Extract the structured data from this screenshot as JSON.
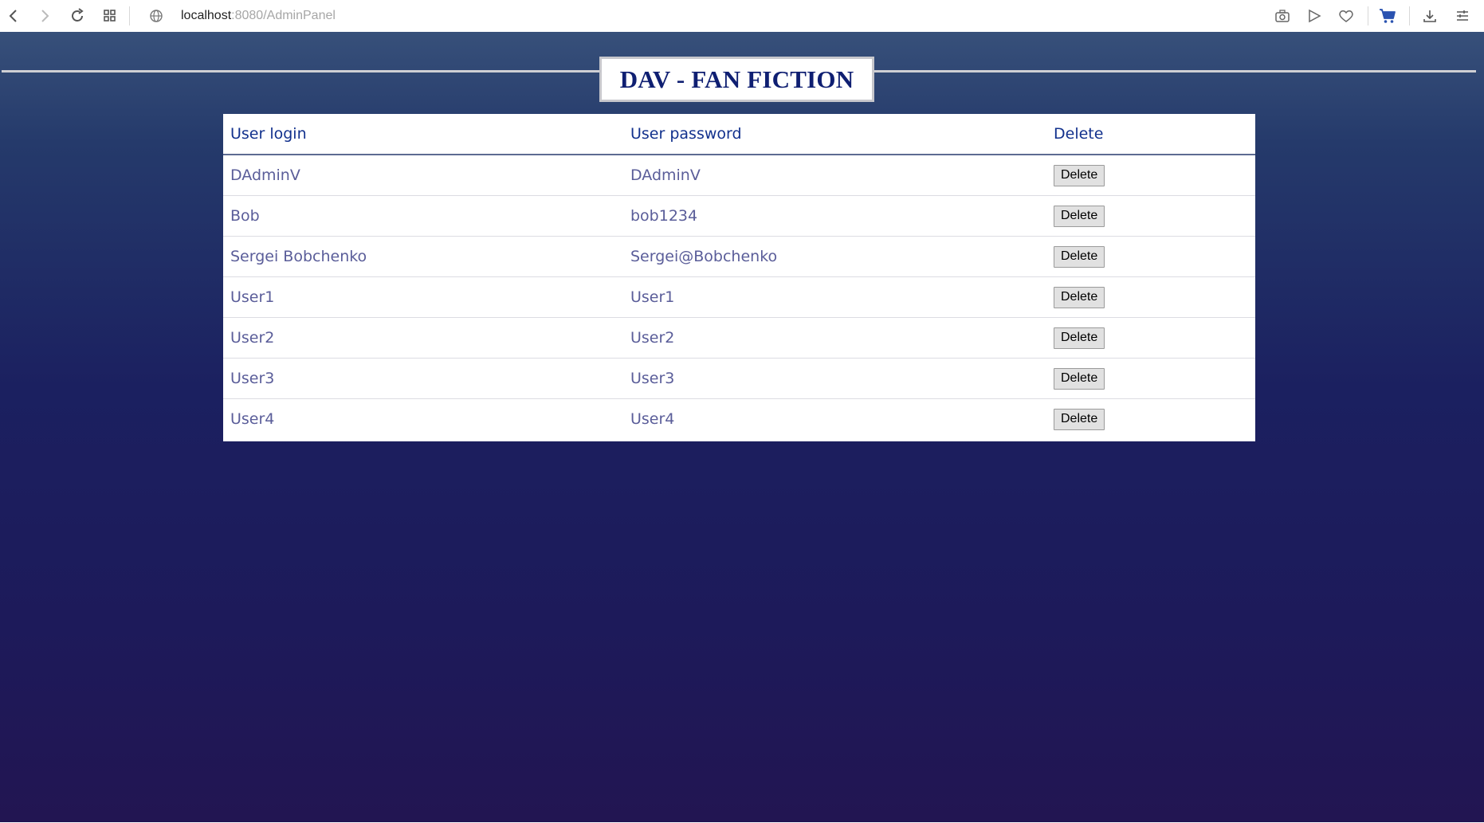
{
  "browser": {
    "url_host": "localhost",
    "url_rest": ":8080/AdminPanel",
    "icons": [
      "back-icon",
      "forward-icon",
      "reload-icon",
      "tabs-grid-icon",
      "globe-icon",
      "camera-icon",
      "send-icon",
      "heart-icon",
      "cart-icon",
      "download-icon",
      "menu-icon"
    ]
  },
  "page": {
    "title": "DAV - FAN FICTION",
    "background_color": "#1d1a5a",
    "accent_color": "#12318d"
  },
  "table": {
    "headers": [
      "User login",
      "User password",
      "Delete"
    ],
    "rows": [
      {
        "login": "DAdminV",
        "password": "DAdminV",
        "action": "Delete"
      },
      {
        "login": "Bob",
        "password": "bob1234",
        "action": "Delete"
      },
      {
        "login": "Sergei Bobchenko",
        "password": "Sergei@Bobchenko",
        "action": "Delete"
      },
      {
        "login": "User1",
        "password": "User1",
        "action": "Delete"
      },
      {
        "login": "User2",
        "password": "User2",
        "action": "Delete"
      },
      {
        "login": "User3",
        "password": "User3",
        "action": "Delete"
      },
      {
        "login": "User4",
        "password": "User4",
        "action": "Delete"
      }
    ]
  }
}
